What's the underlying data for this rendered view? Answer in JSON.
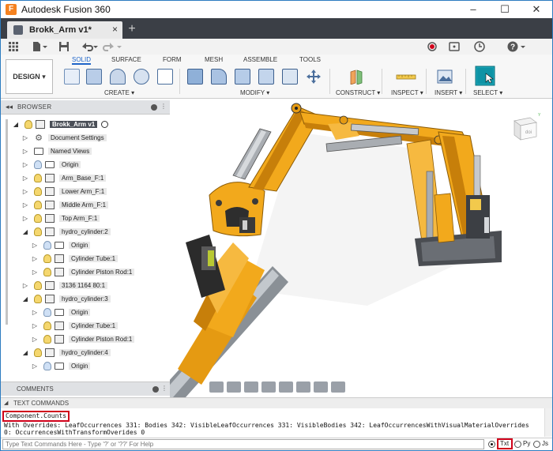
{
  "window": {
    "app_title": "Autodesk Fusion 360",
    "app_icon_letter": "F",
    "minimize": "–",
    "maximize": "☐",
    "close": "✕"
  },
  "tabs": {
    "active_doc": "Brokk_Arm v1*",
    "close_glyph": "×",
    "new_tab_glyph": "+"
  },
  "ribbon": {
    "workspace": "DESIGN ▾",
    "tabs": [
      "SOLID",
      "SURFACE",
      "FORM",
      "MESH",
      "ASSEMBLE",
      "TOOLS"
    ],
    "active_tab": "SOLID",
    "groups": [
      "CREATE ▾",
      "MODIFY ▾",
      "CONSTRUCT ▾",
      "INSPECT ▾",
      "INSERT ▾",
      "SELECT ▾"
    ]
  },
  "browser": {
    "title": "BROWSER",
    "collapse_glyph": "◂◂",
    "items": [
      {
        "label": "Brokk_Arm v1"
      },
      {
        "label": "Document Settings"
      },
      {
        "label": "Named Views"
      },
      {
        "label": "Origin"
      },
      {
        "label": "Arm_Base_F:1"
      },
      {
        "label": "Lower Arm_F:1"
      },
      {
        "label": "Middle Arm_F:1"
      },
      {
        "label": "Top Arm_F:1"
      },
      {
        "label": "hydro_cylinder:2"
      },
      {
        "label": "Origin"
      },
      {
        "label": "Cylinder Tube:1"
      },
      {
        "label": "Cylinder Piston Rod:1"
      },
      {
        "label": "3136 1164 80:1"
      },
      {
        "label": "hydro_cylinder:3"
      },
      {
        "label": "Origin"
      },
      {
        "label": "Cylinder Tube:1"
      },
      {
        "label": "Cylinder Piston Rod:1"
      },
      {
        "label": "hydro_cylinder:4"
      },
      {
        "label": "Origin"
      }
    ]
  },
  "comments": {
    "title": "COMMENTS"
  },
  "viewcube": {
    "face_label": "doi"
  },
  "text_commands": {
    "title": "TEXT COMMANDS",
    "command": "Component.Counts",
    "output_line1": "With Overrides: LeafOccurrences 331: Bodies 342: VisibleLeafOccurrences 331: VisibleBodies 342: LeafOccurrencesWithVisualMaterialOverrides",
    "output_line2": "0: OccurrencesWithTransformOverides 0",
    "input_placeholder": "Type Text Commands Here - Type '?' or '??' For Help",
    "modes": [
      "Txt",
      "Py",
      "Js"
    ],
    "active_mode": "Txt"
  },
  "colors": {
    "accent_blue": "#1e64c8",
    "highlight_red": "#d0021b",
    "arm_orange": "#f2a91c"
  }
}
